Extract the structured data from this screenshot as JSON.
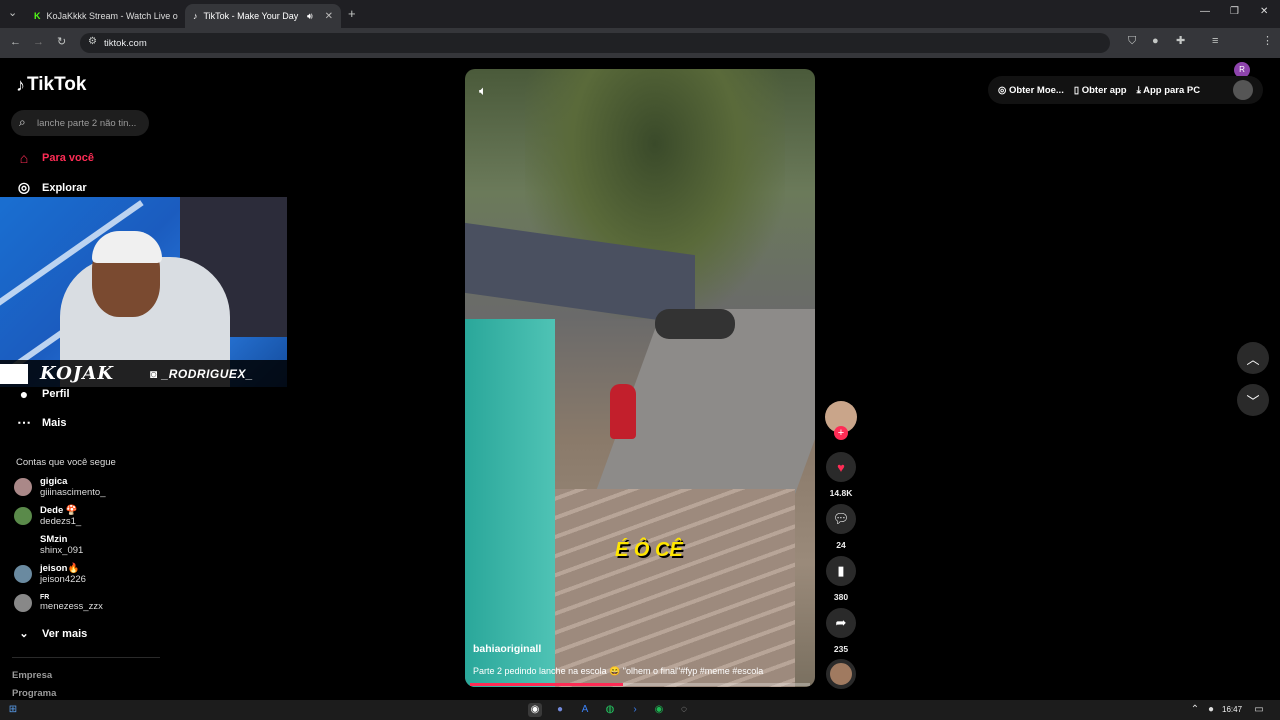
{
  "browser": {
    "tabs": [
      {
        "title": "KoJaKkkk Stream - Watch Live o",
        "active": false
      },
      {
        "title": "TikTok - Make Your Day",
        "active": true
      }
    ],
    "url": "tiktok.com"
  },
  "tiktok": {
    "logo": "TikTok",
    "search_placeholder": "lanche parte 2 não tin...",
    "nav": [
      {
        "label": "Para você",
        "icon": "home-icon",
        "active": true
      },
      {
        "label": "Explorar",
        "icon": "compass-icon",
        "active": false
      },
      {
        "label": "Perfil",
        "icon": "profile-icon",
        "active": false
      },
      {
        "label": "Mais",
        "icon": "more-icon",
        "active": false
      }
    ],
    "following_title": "Contas que você segue",
    "accounts": [
      {
        "name": "gigica",
        "handle": "giiinascimento_"
      },
      {
        "name": "Dede 🍄",
        "handle": "dedezs1_"
      },
      {
        "name": "SMzin",
        "handle": "shinx_091"
      },
      {
        "name": "jeison🔥",
        "handle": "jeison4226"
      },
      {
        "name": "FR",
        "handle": "menezess_zzx"
      }
    ],
    "see_more": "Ver mais",
    "footer": [
      "Empresa",
      "Programa"
    ],
    "top_right": {
      "coins": "Obter Moe...",
      "app": "Obter app",
      "pc": "App para PC"
    },
    "video": {
      "author": "bahiaoriginall",
      "description": "Parte 2 pedindo lanche na escola 😄 \"olhem o final\"#fyp #meme #escola",
      "overlay_text": "É Ô CÊ",
      "progress": 0.45
    },
    "actions": {
      "likes": "14.8K",
      "comments": "24",
      "saves": "380",
      "shares": "235"
    }
  },
  "webcam": {
    "signature": "KOJAK",
    "instagram": "_RODRIGUEX_"
  },
  "taskbar": {
    "time": "16:47"
  }
}
